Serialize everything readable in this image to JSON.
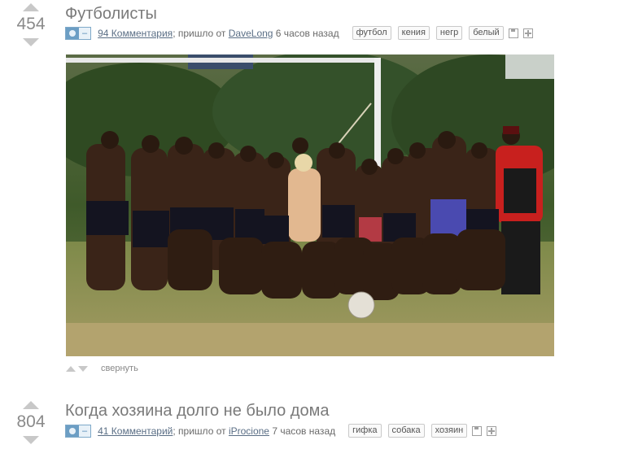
{
  "posts": [
    {
      "score": "454",
      "title": "Футболисты",
      "comments": "94 Комментария",
      "came_from": "; пришло от ",
      "author": "DaveLong",
      "time": " 6 часов назад",
      "tags": [
        "футбол",
        "кения",
        "негр",
        "белый"
      ],
      "image_description_icon": "camera-icon",
      "collapse_label": "свернуть"
    },
    {
      "score": "804",
      "title": "Когда хозяина долго не было дома",
      "comments": "41 Комментарий",
      "came_from": "; пришло от ",
      "author": "iProcione",
      "time": " 7 часов назад",
      "tags": [
        "гифка",
        "собака",
        "хозяин"
      ],
      "image_description_icon": "camera-icon"
    }
  ],
  "camera_minus": "–"
}
